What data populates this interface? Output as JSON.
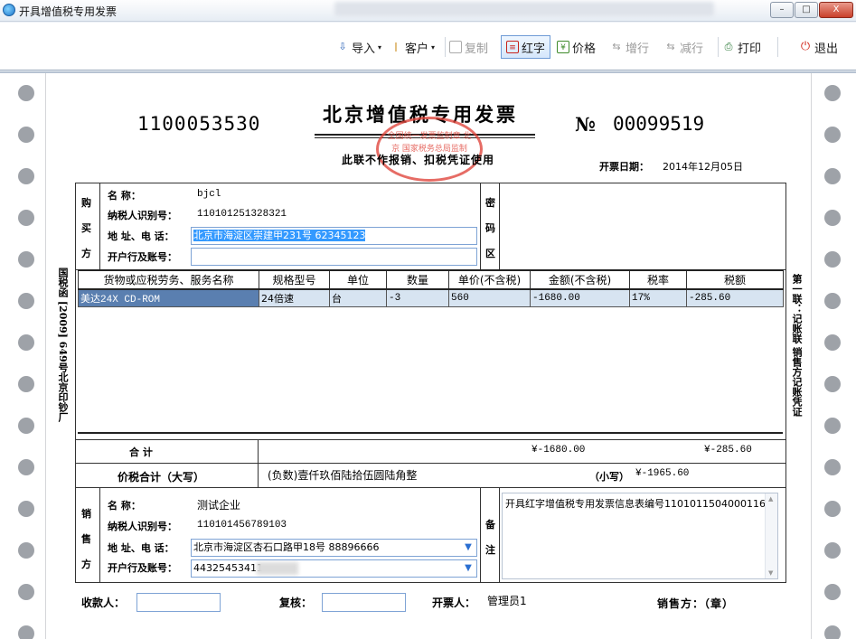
{
  "window": {
    "title": "开具增值税专用发票",
    "controls": {
      "minimize": "–",
      "maximize": "□",
      "close": "X"
    }
  },
  "toolbar": {
    "import": "导入",
    "customer": "客户",
    "copy": "复制",
    "red": "红字",
    "price": "价格",
    "add_row": "增行",
    "del_row": "减行",
    "print": "打印",
    "exit": "退出"
  },
  "invoice": {
    "code": "1100053530",
    "title": "北京增值税专用发票",
    "no_symbol": "№",
    "number": "00099519",
    "subtitle": "此联不作报销、扣税凭证使用",
    "date_label": "开票日期：",
    "date": "2014年12月05日",
    "seal_text": "全国统一发票监制章 北 京 国家税务总局监制",
    "left_margin": "国税函 [2009] 649号北京印钞厂",
    "right_margin": "第一联：记账联 销售方记账凭证"
  },
  "buyer": {
    "side_label": "购 买 方",
    "name_label": "名      称：",
    "name": "bjcl",
    "tax_id_label": "纳税人识别号：",
    "tax_id": "110101251328321",
    "address_label": "地 址、电 话：",
    "address": "北京市海淀区崇建甲231号 62345123",
    "bank_label": "开户行及账号：",
    "bank": ""
  },
  "cipher": {
    "label": "密 码 区"
  },
  "items": {
    "headers": [
      "货物或应税劳务、服务名称",
      "规格型号",
      "单位",
      "数量",
      "单价(不含税)",
      "金额(不含税)",
      "税率",
      "税额"
    ],
    "rows": [
      [
        "美达24X CD-ROM",
        "24倍速",
        "台",
        "-3",
        "560",
        "-1680.00",
        "17%",
        "-285.60"
      ]
    ]
  },
  "totals": {
    "label": "合          计",
    "amount": "¥-1680.00",
    "tax": "¥-285.60",
    "grand_label": "价税合计（大写）",
    "grand_words": "(负数)壹仟玖佰陆拾伍圆陆角整",
    "small_label": "（小写）",
    "grand_small": "¥-1965.60"
  },
  "seller": {
    "side_label": "销 售 方",
    "name_label": "名      称：",
    "name": "测试企业",
    "tax_id_label": "纳税人识别号：",
    "tax_id": "110101456789103",
    "address_label": "地 址、电 话：",
    "address": "北京市海淀区杏石口路甲18号 88896666",
    "bank_label": "开户行及账号：",
    "bank": "44325453411"
  },
  "remarks": {
    "label": "备 注",
    "text": "开具红字增值税专用发票信息表编号1101011504000116"
  },
  "footer": {
    "payee_label": "收款人：",
    "payee": "",
    "reviewer_label": "复核：",
    "reviewer": "",
    "drawer_label": "开票人：",
    "drawer": "管理员1",
    "seller_stamp": "销售方：（章）"
  },
  "colors": {
    "accent": "#3399ff",
    "seal": "#e0443a",
    "row_bg": "#d7e4f1"
  }
}
